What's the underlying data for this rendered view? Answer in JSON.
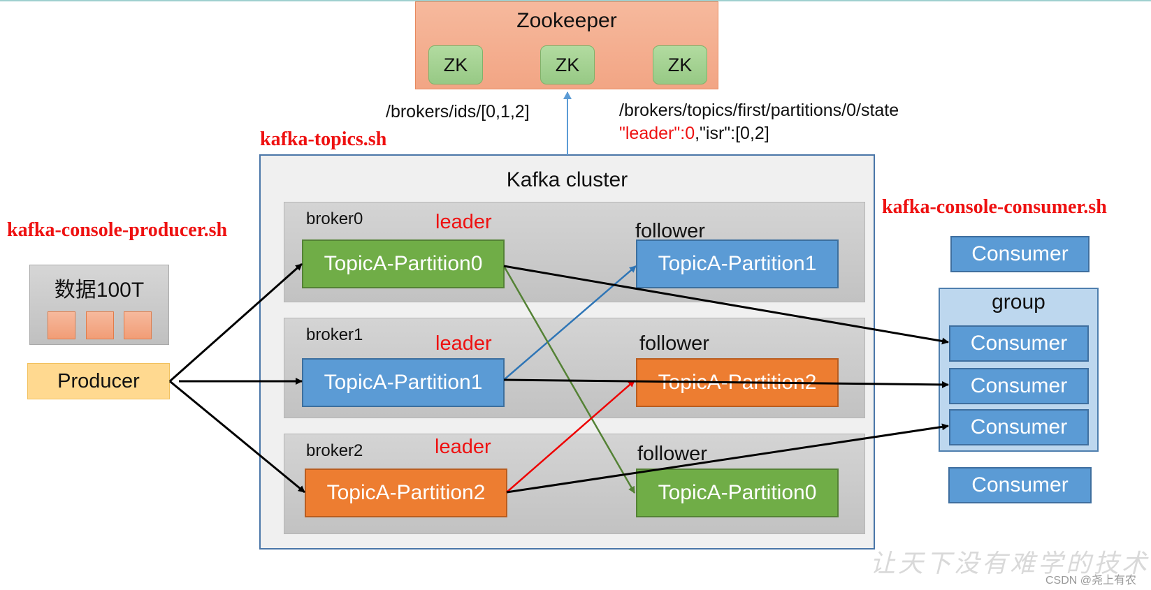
{
  "zookeeper": {
    "title": "Zookeeper",
    "nodes": [
      "ZK",
      "ZK",
      "ZK"
    ]
  },
  "zk_paths": {
    "broker_ids": "/brokers/ids/[0,1,2]",
    "partition_state_path": "/brokers/topics/first/partitions/0/state",
    "state_leader_part": "\"leader\":0",
    "state_rest_part": ",\"isr\":[0,2]"
  },
  "scripts": {
    "topics": "kafka-topics.sh",
    "producer": "kafka-console-producer.sh",
    "consumer": "kafka-console-consumer.sh"
  },
  "cluster": {
    "title": "Kafka cluster",
    "brokers": [
      {
        "name": "broker0",
        "leader_label": "leader",
        "leader_partition": "TopicA-Partition0",
        "follower_label": "follower",
        "follower_partition": "TopicA-Partition1"
      },
      {
        "name": "broker1",
        "leader_label": "leader",
        "leader_partition": "TopicA-Partition1",
        "follower_label": "follower",
        "follower_partition": "TopicA-Partition2"
      },
      {
        "name": "broker2",
        "leader_label": "leader",
        "leader_partition": "TopicA-Partition2",
        "follower_label": "follower",
        "follower_partition": "TopicA-Partition0"
      }
    ]
  },
  "source": {
    "data_label": "数据100T",
    "producer_label": "Producer"
  },
  "consumers": {
    "standalone_top": "Consumer",
    "group_title": "group",
    "group_members": [
      "Consumer",
      "Consumer",
      "Consumer"
    ],
    "standalone_bottom": "Consumer"
  },
  "colors": {
    "leader_text": "#ee1111",
    "partition0": "#70ad47",
    "partition1": "#5b9bd5",
    "partition2": "#ed7d31",
    "producer": "#ffd990",
    "zookeeper": "#f4ac8c"
  },
  "watermark": {
    "slogan": "让天下没有难学的技术",
    "credit": "CSDN @尧上有农"
  }
}
